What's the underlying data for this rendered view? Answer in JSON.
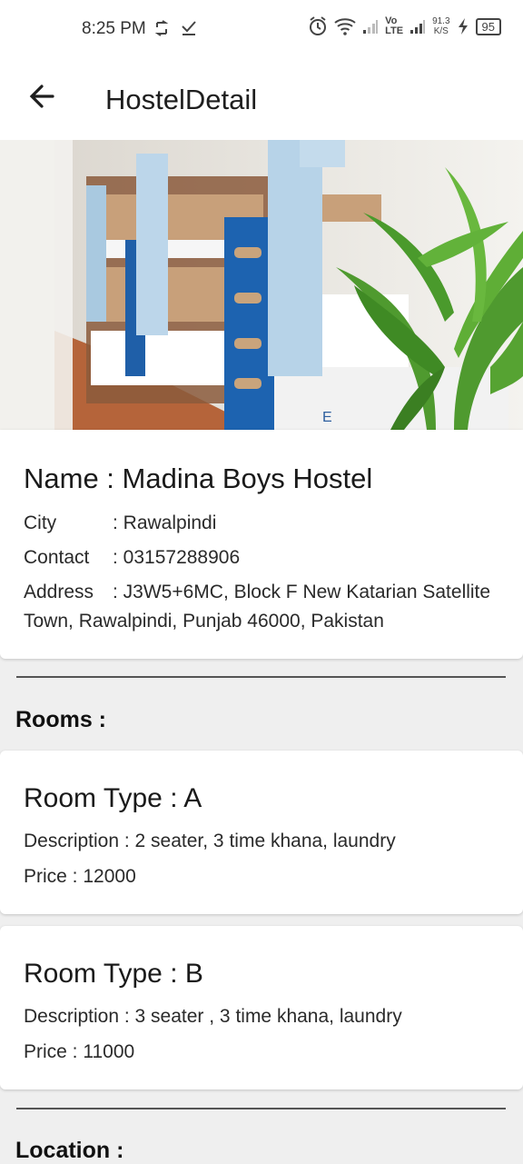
{
  "status_bar": {
    "time": "8:25 PM",
    "speed_top": "91.3",
    "speed_bottom": "K/S",
    "network_top": "Vo",
    "network_bottom": "LTE",
    "battery": "95"
  },
  "app_bar": {
    "title": "HostelDetail"
  },
  "hostel": {
    "name_label": "Name : Madina Boys Hostel",
    "city_label": "City",
    "city_value": ": Rawalpindi",
    "contact_label": "Contact",
    "contact_value": ": 03157288906",
    "address_label": "Address",
    "address_value": ": J3W5+6MC, Block F New Katarian Satellite Town, Rawalpindi, Punjab 46000, Pakistan"
  },
  "rooms_heading": "Rooms :",
  "rooms": [
    {
      "title": "Room Type : A",
      "description": "Description : 2 seater, 3 time khana, laundry",
      "price": "Price : 12000"
    },
    {
      "title": "Room Type : B",
      "description": "Description : 3 seater , 3 time khana, laundry",
      "price": "Price : 11000"
    }
  ],
  "location_heading": "Location :"
}
